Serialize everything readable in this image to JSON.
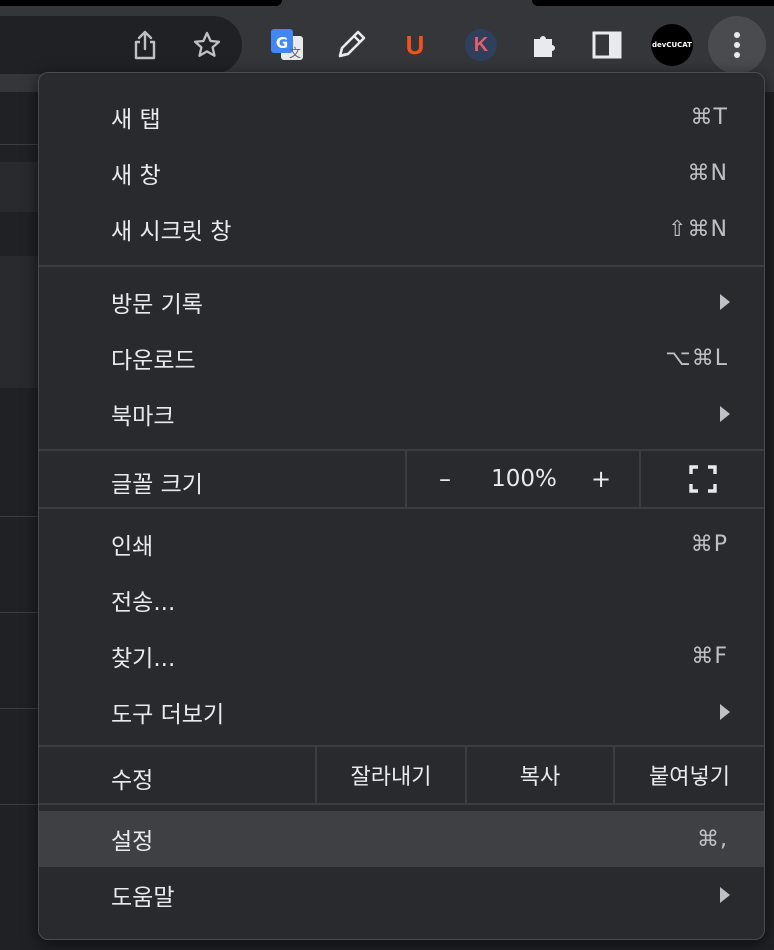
{
  "toolbar": {
    "icons": [
      "share-icon",
      "star-icon",
      "google-translate-icon",
      "pencil-icon",
      "u-extension-icon",
      "k-extension-icon",
      "puzzle-icon",
      "side-panel-icon"
    ],
    "profile_label": "devCUCAT",
    "translate_g": "G",
    "translate_char": "文",
    "u_letter": "U",
    "k_letter": "K"
  },
  "menu": {
    "new_tab": {
      "label": "새 탭",
      "shortcut": "⌘T"
    },
    "new_window": {
      "label": "새 창",
      "shortcut": "⌘N"
    },
    "incognito": {
      "label": "새 시크릿 창",
      "shortcut": "⇧⌘N"
    },
    "history": {
      "label": "방문 기록"
    },
    "downloads": {
      "label": "다운로드",
      "shortcut": "⌥⌘L"
    },
    "bookmarks": {
      "label": "북마크"
    },
    "zoom": {
      "label": "글꼴 크기",
      "minus": "–",
      "value": "100%",
      "plus": "+"
    },
    "print": {
      "label": "인쇄",
      "shortcut": "⌘P"
    },
    "cast": {
      "label": "전송..."
    },
    "find": {
      "label": "찾기...",
      "shortcut": "⌘F"
    },
    "more_tools": {
      "label": "도구 더보기"
    },
    "edit": {
      "label": "수정",
      "cut": "잘라내기",
      "copy": "복사",
      "paste": "붙여넣기"
    },
    "settings": {
      "label": "설정",
      "shortcut": "⌘,"
    },
    "help": {
      "label": "도움말"
    }
  },
  "colors": {
    "menu_bg": "#292a2d",
    "highlight": "#3f4043",
    "toolbar_bg": "#35363a"
  }
}
